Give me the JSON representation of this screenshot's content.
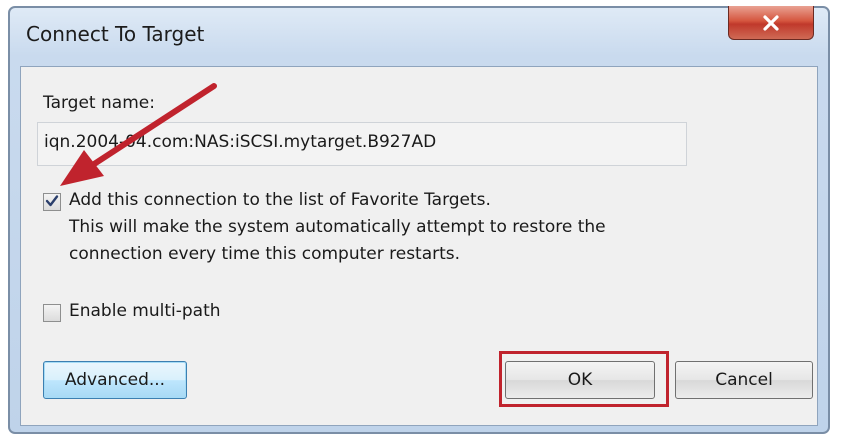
{
  "window": {
    "title": "Connect To Target",
    "close_icon": "close-icon"
  },
  "target": {
    "label": "Target name:",
    "value": "iqn.2004-04.com:NAS:iSCSI.mytarget.B927AD"
  },
  "favorites": {
    "checked": true,
    "label": "Add this connection to the list of Favorite Targets.",
    "description_line1": "This will make the system automatically attempt to restore the",
    "description_line2": "connection every time this computer restarts."
  },
  "multipath": {
    "checked": false,
    "label": "Enable multi-path"
  },
  "buttons": {
    "advanced_label": "Advanced...",
    "ok_label": "OK",
    "cancel_label": "Cancel"
  },
  "annotations": {
    "arrow_color": "#c0232d",
    "highlight_color": "#c0232d"
  }
}
